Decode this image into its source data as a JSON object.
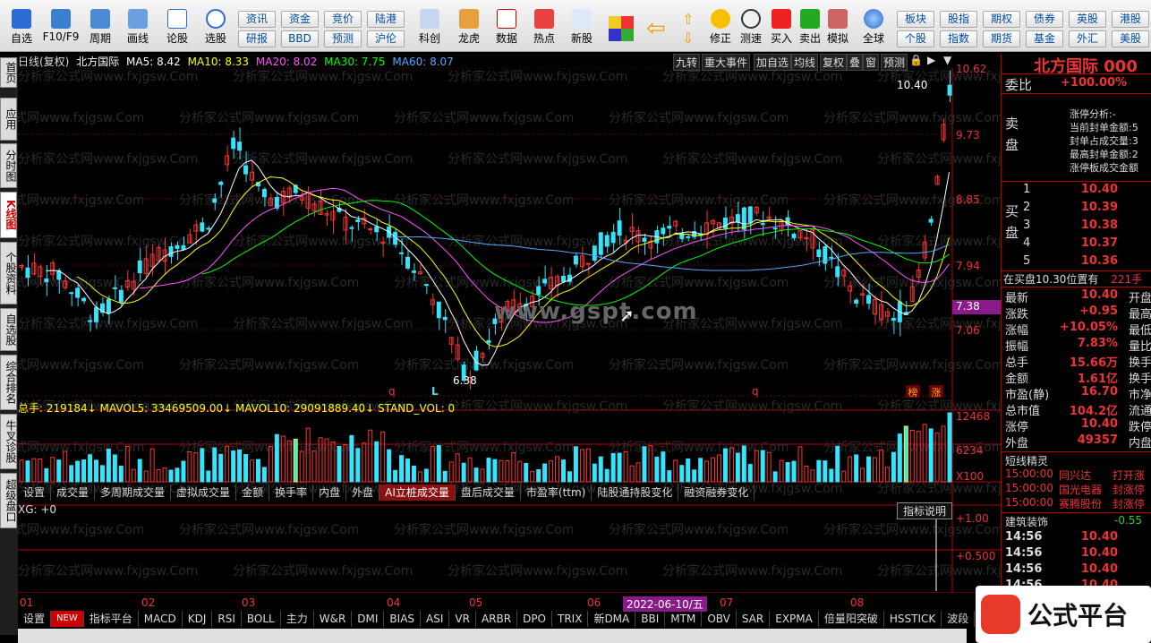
{
  "toolbar": {
    "big": [
      {
        "label": "自选",
        "icon": "star-icon"
      },
      {
        "label": "F10/F9",
        "icon": "f10-icon"
      },
      {
        "label": "周期",
        "icon": "cycle-icon"
      },
      {
        "label": "画线",
        "icon": "pen-icon"
      },
      {
        "label": "论股",
        "icon": "discuss-icon"
      },
      {
        "label": "选股",
        "icon": "screener-icon"
      }
    ],
    "small_left": [
      "资讯",
      "资金",
      "竞价",
      "陆港",
      "研报",
      "BBD",
      "预测",
      "沪伦"
    ],
    "mid": [
      {
        "label": "科创",
        "icon": "star-market-icon"
      },
      {
        "label": "龙虎",
        "icon": "dragon-tiger-icon"
      },
      {
        "label": "数据",
        "icon": "pe-data-icon"
      },
      {
        "label": "热点",
        "icon": "hot-icon"
      },
      {
        "label": "新股",
        "icon": "new-stock-icon"
      }
    ],
    "tools": [
      {
        "label": "修正",
        "icon": "fix-icon"
      },
      {
        "label": "测速",
        "icon": "speed-icon"
      },
      {
        "label": "买入",
        "icon": "buy-icon"
      },
      {
        "label": "卖出",
        "icon": "sell-icon"
      },
      {
        "label": "模拟",
        "icon": "simulate-icon"
      },
      {
        "label": "全球",
        "icon": "globe-icon"
      }
    ],
    "small_right": [
      "板块",
      "股指",
      "期权",
      "债券",
      "英股",
      "港股",
      "个股",
      "指数",
      "期货",
      "基金",
      "外汇",
      "美股"
    ]
  },
  "left_rail": [
    "首页",
    "应用",
    "分时图",
    "K线图",
    "个股资料",
    "自选股",
    "综合排名",
    "牛叉诊股",
    "超级盘口"
  ],
  "chart": {
    "info_label": "日线(复权)",
    "stock_name": "北方国际",
    "ma": [
      {
        "label": "MA5: 8.42",
        "color": "#ffffff"
      },
      {
        "label": "MA10: 8.33",
        "color": "#ffff00"
      },
      {
        "label": "MA20: 8.02",
        "color": "#ff55ff"
      },
      {
        "label": "MA30: 7.75",
        "color": "#00ff00"
      },
      {
        "label": "MA60: 8.07",
        "color": "#55aaff"
      }
    ],
    "buttons": [
      "九转",
      "重大事件",
      "加自选",
      "均线",
      "复权",
      "叠",
      "窗",
      "预测"
    ],
    "price_axis": [
      "10.62",
      "9.73",
      "8.85",
      "7.94",
      "7.06"
    ],
    "current_price_tag": "7.38",
    "high_label": "10.40",
    "low_label": "6.38",
    "marker_l": "L",
    "markers_q": [
      "q",
      "q"
    ],
    "badge_bang": "榜",
    "badge_zhang": "涨",
    "watermark": "www.gspt.com",
    "watermark_small": "分析家公式网www.fxjgsw.Com"
  },
  "volume": {
    "info": "总手: 219184↓ MAVOL5: 33469509.00↓ MAVOL10: 29091889.40↓ STAND_VOL: 0",
    "axis": [
      "12468",
      "6234",
      "X100"
    ],
    "tabs": [
      "设置",
      "成交量",
      "多周期成交量",
      "虚拟成交量",
      "金额",
      "换手率",
      "内盘",
      "外盘",
      "AI立桩成交量",
      "盘后成交量",
      "市盈率(ttm)",
      "陆股通持股变化",
      "融资融券变化"
    ],
    "active_tab": "AI立桩成交量"
  },
  "indicator": {
    "label": "XG: +0",
    "axis": [
      "+1.00",
      "+0.500"
    ],
    "explain": "指标说明"
  },
  "x_axis": {
    "months": [
      "01",
      "02",
      "03",
      "04",
      "05",
      "06",
      "07",
      "08"
    ],
    "cursor_date": "2022-06-10/五"
  },
  "bottom_tabs": [
    "设置",
    "NEW",
    "指标平台",
    "MACD",
    "KDJ",
    "RSI",
    "BOLL",
    "主力",
    "W&R",
    "DMI",
    "BIAS",
    "ASI",
    "VR",
    "ARBR",
    "DPO",
    "TRIX",
    "新DMA",
    "BBI",
    "MTM",
    "OBV",
    "SAR",
    "EXPMA",
    "倍量阳突破",
    "HSSTICK",
    "波段"
  ],
  "right_panel": {
    "title": "北方国际 000",
    "weibi_label": "委比",
    "weibi_value": "+100.00%",
    "sell_label": "卖盘",
    "buy_label": "买盘",
    "limit_analysis": [
      "涨停分析:-",
      "当前封单金额:5",
      "封单占成交量:3",
      "最高封单金额:2",
      "涨停板成交金额"
    ],
    "bids": [
      {
        "n": "1",
        "p": "10.40"
      },
      {
        "n": "2",
        "p": "10.39"
      },
      {
        "n": "3",
        "p": "10.38"
      },
      {
        "n": "4",
        "p": "10.37"
      },
      {
        "n": "5",
        "p": "10.36"
      }
    ],
    "buy_note": "在买盘10.30位置有",
    "buy_note_val": "221手",
    "quotes": [
      {
        "k": "最新",
        "v": "10.40",
        "k2": "开盘"
      },
      {
        "k": "涨跌",
        "v": "+0.95",
        "k2": "最高"
      },
      {
        "k": "涨幅",
        "v": "+10.05%",
        "k2": "最低"
      },
      {
        "k": "振幅",
        "v": "7.83%",
        "k2": "量比"
      },
      {
        "k": "总手",
        "v": "15.66万",
        "k2": "换手"
      },
      {
        "k": "金额",
        "v": "1.61亿",
        "k2": "换手"
      },
      {
        "k": "市盈(静)",
        "v": "16.70",
        "k2": "市净"
      },
      {
        "k": "总市值",
        "v": "104.2亿",
        "k2": "流通"
      },
      {
        "k": "涨停",
        "v": "10.40",
        "k2": "跌停"
      },
      {
        "k": "外盘",
        "v": "49357",
        "k2": "内盘"
      }
    ],
    "sprite_title": "短线精灵",
    "sprites": [
      {
        "t": "15:00:00",
        "name": "同兴达",
        "act": "打开涨"
      },
      {
        "t": "15:00:00",
        "name": "国光电器",
        "act": "封涨停"
      },
      {
        "t": "15:00:00",
        "name": "赛腾股份",
        "act": "封涨停"
      }
    ],
    "sector": "建筑装饰",
    "sector_val": "-0.55",
    "ticks": [
      {
        "t": "14:56",
        "p": "10.40"
      },
      {
        "t": "14:56",
        "p": "10.40"
      },
      {
        "t": "14:56",
        "p": "10.40"
      },
      {
        "t": "14:56",
        "p": "10.40"
      }
    ]
  },
  "brand": "公式平台",
  "colors": {
    "up": "#ff3333",
    "down": "#33e5ff",
    "bg": "#000000",
    "grid": "#6b0000"
  }
}
